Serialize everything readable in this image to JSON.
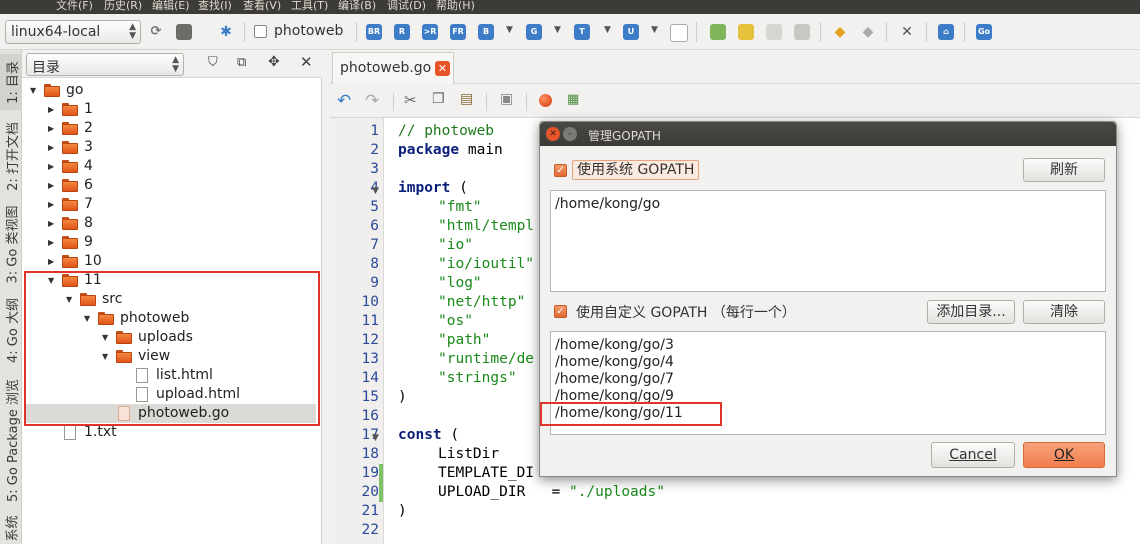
{
  "menubar": {
    "items": [
      "文件(F)",
      "历史(R)",
      "编辑(E)",
      "查找(I)",
      "查看(V)",
      "工具(T)",
      "编译(B)",
      "调试(D)",
      "帮助(H)"
    ]
  },
  "toolbar": {
    "env_select": "linux64-local",
    "file_check_label": "photoweb",
    "icon_labels": [
      "BR",
      "R",
      ">R",
      "FR",
      "B",
      "G",
      "T",
      "U",
      "Go"
    ]
  },
  "left_tabs": [
    "1: 目录",
    "2: 打开文档",
    "3: Go 类视图",
    "4: Go 大纲",
    "5: Go Package 浏览",
    "系统"
  ],
  "panel": {
    "combo": "目录",
    "tree": [
      {
        "label": "go"
      },
      {
        "label": "1"
      },
      {
        "label": "2"
      },
      {
        "label": "3"
      },
      {
        "label": "4"
      },
      {
        "label": "6"
      },
      {
        "label": "7"
      },
      {
        "label": "8"
      },
      {
        "label": "9"
      },
      {
        "label": "10"
      },
      {
        "label": "11"
      },
      {
        "label": "src"
      },
      {
        "label": "photoweb"
      },
      {
        "label": "uploads"
      },
      {
        "label": "view"
      },
      {
        "label": "list.html"
      },
      {
        "label": "upload.html"
      },
      {
        "label": "photoweb.go"
      },
      {
        "label": "1.txt"
      }
    ]
  },
  "editor": {
    "tab_label": "photoweb.go",
    "line_numbers": [
      "1",
      "2",
      "3",
      "4",
      "5",
      "6",
      "7",
      "8",
      "9",
      "10",
      "11",
      "12",
      "13",
      "14",
      "15",
      "16",
      "17",
      "18",
      "19",
      "20",
      "21",
      "22"
    ],
    "code": {
      "l1": "// photoweb",
      "l2a": "package",
      "l2b": " main",
      "l4a": "import",
      "l4b": " (",
      "l5": "\"fmt\"",
      "l6": "\"html/templ",
      "l7": "\"io\"",
      "l8": "\"io/ioutil\"",
      "l9": "\"log\"",
      "l10": "\"net/http\"",
      "l11": "\"os\"",
      "l12": "\"path\"",
      "l13": "\"runtime/de",
      "l14": "\"strings\"",
      "l15": ")",
      "l17a": "const",
      "l17b": " (",
      "l18": "ListDir",
      "l19": "TEMPLATE_DI",
      "l20a": "UPLOAD_DIR   = ",
      "l20b": "\"./uploads\"",
      "l21": ")"
    }
  },
  "dialog": {
    "title": "管理GOPATH",
    "use_system_label": "使用系统 GOPATH",
    "refresh_button": "刷新",
    "system_paths": [
      "/home/kong/go"
    ],
    "use_custom_label": "使用自定义 GOPATH （每行一个）",
    "add_dir_button": "添加目录...",
    "clear_button": "清除",
    "custom_paths": [
      "/home/kong/go/3",
      "/home/kong/go/4",
      "/home/kong/go/7",
      "/home/kong/go/9",
      "/home/kong/go/11"
    ],
    "cancel_button": "Cancel",
    "ok_button": "OK"
  },
  "colors": {
    "accent": "#f07d4d",
    "folder": "#e9652a",
    "highlight_box": "#e0342a",
    "title_bar": "#3c3b37"
  }
}
